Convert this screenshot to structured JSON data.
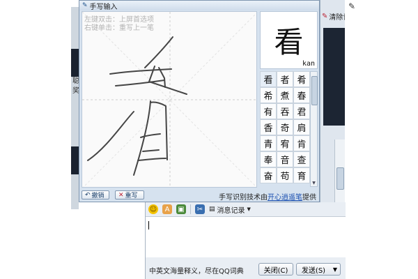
{
  "window": {
    "title": "手写输入",
    "hints": [
      "左键双击：上屏首选项",
      "右键单击：重写上一笔"
    ],
    "preview": {
      "char": "看",
      "pinyin": "kan"
    },
    "candidates": [
      "看",
      "者",
      "肴",
      "希",
      "煮",
      "春",
      "有",
      "吞",
      "君",
      "香",
      "奇",
      "肩",
      "青",
      "宥",
      "肯",
      "奉",
      "音",
      "查",
      "奋",
      "苟",
      "育"
    ],
    "undo_label": "撤销",
    "redo_label": "重写",
    "tech_prefix": "手写识别技术由",
    "tech_link": "开心逍遥笔",
    "tech_suffix": "提供"
  },
  "background": {
    "clear_label": "清除记",
    "left_text": [
      "聪",
      "奖"
    ]
  },
  "chat": {
    "history_label": "消息记录",
    "dict_text": "中英文海量释义，尽在QQ词典",
    "close_label": "关闭(C)",
    "send_label": "发送(S)"
  },
  "colors": {
    "ink": "#454545",
    "link": "#1a4fb0",
    "window_bg": "#d6e2ef"
  },
  "icons": [
    "pen-icon",
    "smile-icon",
    "font-icon",
    "image-icon",
    "screenshot-icon",
    "history-icon",
    "undo-icon",
    "redo-icon",
    "wrench-icon",
    "clear-icon"
  ]
}
